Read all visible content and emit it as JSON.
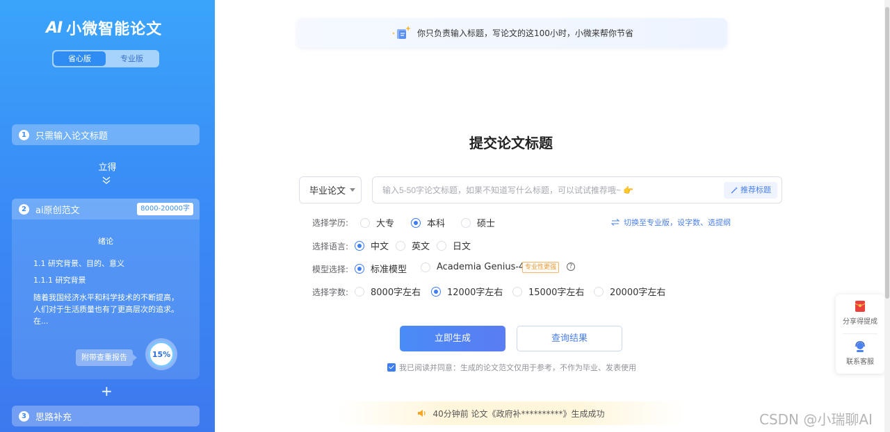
{
  "sidebar": {
    "logo_mark": "AI",
    "logo_text": "小微智能论文",
    "versions": [
      "省心版",
      "专业版"
    ],
    "steps": [
      {
        "num": "1",
        "label": "只需输入论文标题"
      },
      {
        "num": "2",
        "label": "ai原创范文",
        "badge": "8000-20000字"
      },
      {
        "num": "3",
        "label": "思路补充"
      }
    ],
    "instant_text": "立得",
    "draft": {
      "title": "绪论",
      "line1": "1.1 研究背景、目的、意义",
      "line2": "1.1.1 研究背景",
      "para": "随着我国经济水平和科学技术的不断提高，人们对于生活质量也有了更高层次的追求。在...",
      "report_tag": "附带查重报告",
      "progress_label": "15%",
      "progress_value": 0.15
    },
    "plus": "+"
  },
  "banner": {
    "text": "你只负责输入标题，写论文的这100小时，小微来帮你节省"
  },
  "main": {
    "title": "提交论文标题",
    "type_select": "毕业论文",
    "title_input": {
      "value": "",
      "placeholder": "输入5-50字论文标题，如果不知道写什么标题，可以试试推荐哦~ 👉"
    },
    "recommend_button": "推荐标题",
    "education": {
      "label": "选择学历:",
      "options": [
        "大专",
        "本科",
        "硕士"
      ],
      "selected": "本科"
    },
    "switch_link": "切换至专业版，设字数、选提纲",
    "language": {
      "label": "选择语言:",
      "options": [
        "中文",
        "英文",
        "日文"
      ],
      "selected": "中文"
    },
    "model": {
      "label": "模型选择:",
      "options": [
        "标准模型",
        "Academia Genius-4.0"
      ],
      "selected": "标准模型",
      "pro_tag": "专业性更强",
      "help": "?"
    },
    "words": {
      "label": "选择字数:",
      "options": [
        "8000字左右",
        "12000字左右",
        "15000字左右",
        "20000字左右"
      ],
      "selected": "12000字左右"
    },
    "generate_button": "立即生成",
    "query_button": "查询结果",
    "agreement": "我已阅读并同意：生成的论文范文仅用于参考，不作为毕业、发表使用",
    "agreement_checked": true,
    "notice": "40分钟前  论文《政府补**********》生成成功"
  },
  "float_panel": {
    "share": "分享得提成",
    "service": "联系客服"
  },
  "watermark": "CSDN @小瑞聊AI",
  "colors": {
    "accent": "#3d7ef5",
    "sidebar_top": "#3aa4fa",
    "sidebar_bottom": "#3c79ee",
    "pro_tag": "#e89b3c",
    "share_red": "#e8403a"
  }
}
